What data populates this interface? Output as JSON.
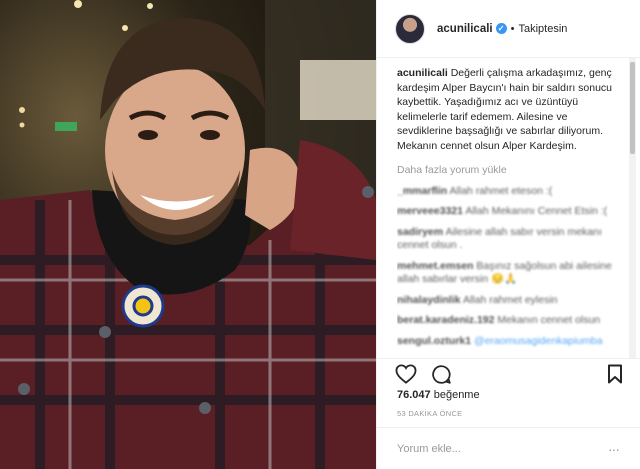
{
  "post": {
    "photo_alt": "post-photo",
    "author": {
      "username": "acunilicali",
      "verified_icon": "verified-badge-icon",
      "separator": "•",
      "follow_label": "Takiptesin"
    },
    "caption": {
      "username": "acunilicali",
      "text": "Değerli çalışma arkadaşımız, genç kardeşim Alper Baycın'ı hain bir saldırı sonucu kaybettik. Yaşadığımız acı ve üzüntüyü kelimelerle tarif edemem. Ailesine ve sevdiklerine başsağlığı ve sabırlar diliyorum. Mekanın cennet olsun Alper Kardeşim."
    },
    "load_more_label": "Daha fazla yorum yükle",
    "comments": [
      {
        "user": "_mmarflin",
        "text": "Allah rahmet eteson :("
      },
      {
        "user": "merveee3321",
        "text": "Allah Mekanını Cennet Etsin :("
      },
      {
        "user": "sadiryem",
        "text": "Ailesine allah sabır versin mekanı cennet olsun ."
      },
      {
        "user": "mehmet.emsen",
        "text": "Başınız sağolsun abi ailesine allah sabırlar versin 😔🙏"
      },
      {
        "user": "nihalaydinlik",
        "text": "Allah rahmet eylesin"
      },
      {
        "user": "berat.karadeniz.192",
        "text": "Mekanın cennet olsun"
      },
      {
        "user": "sengul.ozturk1",
        "text": "@eraomusagidenkapiumba"
      }
    ],
    "actions": {
      "like_icon": "heart-icon",
      "comment_icon": "comment-icon",
      "save_icon": "bookmark-icon"
    },
    "likes": {
      "count": "76.047",
      "label": "beğenme"
    },
    "time_ago": "53 DAKİKA ÖNCE",
    "comment_input": {
      "placeholder": "Yorum ekle...",
      "value": ""
    },
    "more_label": "···"
  }
}
